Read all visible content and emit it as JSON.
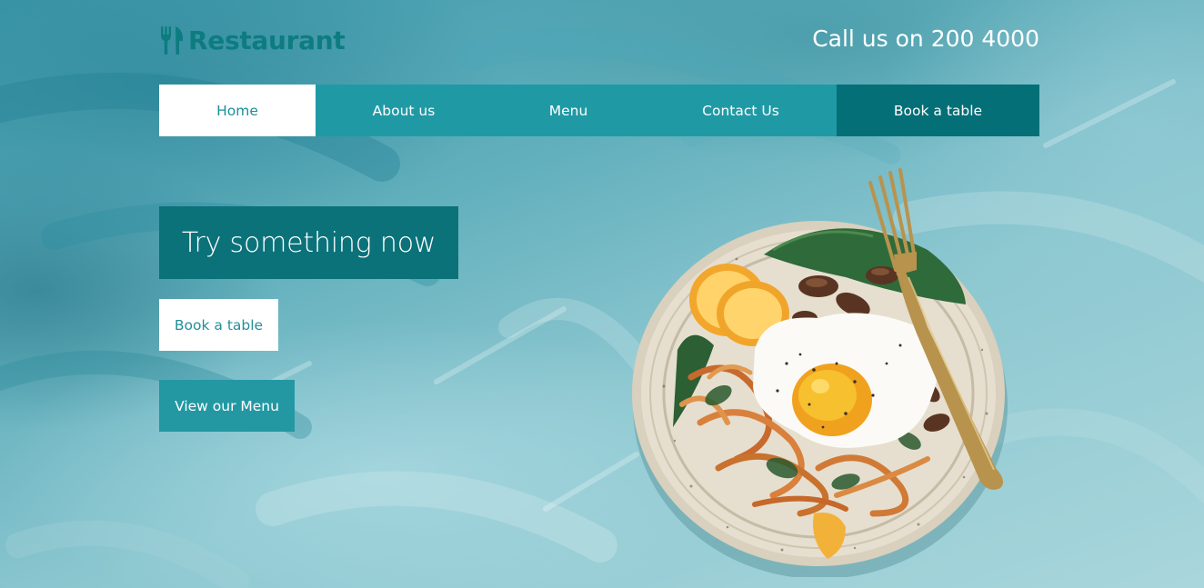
{
  "brand": {
    "name": "Restaurant",
    "color": "#0d7c80",
    "icon": "fork-knife-icon"
  },
  "header": {
    "phone_text": "Call us on 200 4000"
  },
  "nav": {
    "items": [
      {
        "label": "Home"
      },
      {
        "label": "About us"
      },
      {
        "label": "Menu"
      },
      {
        "label": "Contact Us"
      },
      {
        "label": "Book a table"
      }
    ],
    "active": "Home",
    "colors": {
      "bar": "#1f9aa5",
      "active_bg": "#ffffff",
      "cta_bg": "#046f76"
    }
  },
  "hero": {
    "title": "Try something now",
    "book_button": "Book a table",
    "menu_button": "View our Menu",
    "image": "plate-of-food-with-egg-and-fork"
  }
}
